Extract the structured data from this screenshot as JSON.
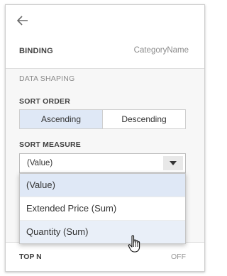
{
  "binding": {
    "label": "BINDING",
    "value": "CategoryName"
  },
  "data_shaping": {
    "title": "DATA SHAPING",
    "sort_order": {
      "label": "SORT ORDER",
      "options": [
        "Ascending",
        "Descending"
      ],
      "selected": "Ascending"
    },
    "sort_measure": {
      "label": "SORT MEASURE",
      "value": "(Value)",
      "options": [
        "(Value)",
        "Extended Price (Sum)",
        "Quantity (Sum)"
      ]
    }
  },
  "top_n": {
    "label": "TOP N",
    "value": "OFF"
  },
  "colors": {
    "accent_selected": "#dfe8f6",
    "hover": "#e9eff8"
  },
  "icons": {
    "back": "arrow-left-icon",
    "dropdown": "caret-down-icon",
    "cursor": "hand-pointer-icon"
  }
}
